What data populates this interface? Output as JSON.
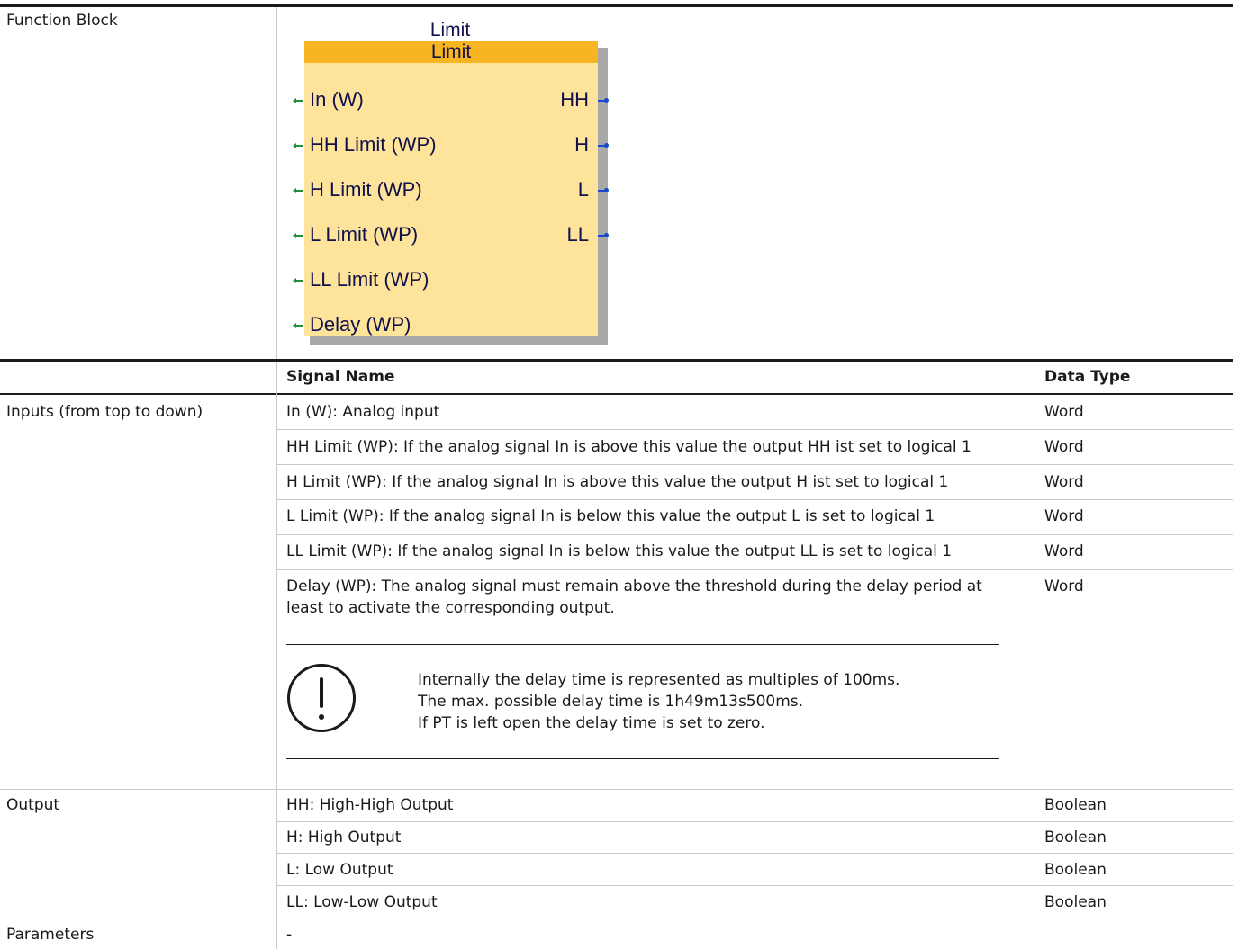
{
  "function_block": {
    "row_label": "Function Block",
    "diagram": {
      "title": "Limit",
      "header": "Limit",
      "inputs": [
        "In (W)",
        "HH Limit (WP)",
        "H  Limit (WP)",
        "L  Limit (WP)",
        "LL Limit (WP)",
        "Delay (WP)"
      ],
      "outputs": [
        "HH",
        "H",
        "L",
        "LL"
      ],
      "colors": {
        "header": "#f6b521",
        "body": "#fde49a",
        "input_pin": "#1f8f3a",
        "output_pin": "#1b46d0"
      }
    }
  },
  "table": {
    "headers": {
      "signal_name": "Signal Name",
      "data_type": "Data Type"
    },
    "inputs": {
      "label": "Inputs (from top to down)",
      "rows": [
        {
          "signal": "In (W): Analog input",
          "type": "Word"
        },
        {
          "signal": "HH Limit (WP): If the analog signal In is above this value the output HH ist set to logical 1",
          "type": "Word"
        },
        {
          "signal": "H Limit (WP): If the analog signal In is above this value the output H ist set to logical 1",
          "type": "Word"
        },
        {
          "signal": "L Limit (WP): If the analog signal In is below this value the output L is set to logical 1",
          "type": "Word"
        },
        {
          "signal": "LL Limit (WP): If the analog signal In is below this value the output LL is set to logical 1",
          "type": "Word"
        },
        {
          "signal_line1": "Delay (WP): The analog signal must remain above the threshold during the delay period at",
          "signal_line2": "least to activate the corresponding output.",
          "type": "Word"
        }
      ],
      "note": {
        "icon": "exclamation-circle-icon",
        "lines": [
          "Internally the delay time is represented as multiples of 100ms.",
          "The max. possible delay time is 1h49m13s500ms.",
          "If PT is left open the delay time is set to zero."
        ]
      }
    },
    "output": {
      "label": "Output",
      "rows": [
        {
          "signal": "HH: High-High Output",
          "type": "Boolean"
        },
        {
          "signal": "H: High Output",
          "type": "Boolean"
        },
        {
          "signal": "L: Low Output",
          "type": "Boolean"
        },
        {
          "signal": "LL: Low-Low Output",
          "type": "Boolean"
        }
      ]
    },
    "parameters": {
      "label": "Parameters",
      "value": "-"
    }
  }
}
